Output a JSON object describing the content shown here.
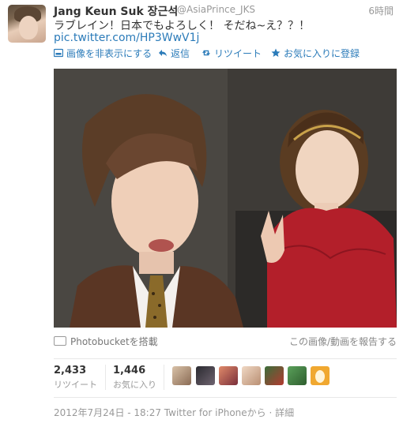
{
  "header": {
    "name": "Jang Keun Suk 장근석",
    "handle": "@AsiaPrince_JKS",
    "time": "6時間"
  },
  "tweet": {
    "text": "ラブレイン！日本でもよろしく！ そだね~え？？！",
    "link": "pic.twitter.com/HP3WwV1j"
  },
  "actions": {
    "hide_image": "画像を非表示にする",
    "reply": "返信",
    "retweet": "リツイート",
    "favorite": "お気に入りに登録"
  },
  "photo_footer": {
    "photobucket": "Photobucketを搭載",
    "report": "この画像/動画を報告する"
  },
  "stats": {
    "retweets": {
      "count": "2,433",
      "label": "リツイート"
    },
    "favorites": {
      "count": "1,446",
      "label": "お気に入り"
    }
  },
  "footer": {
    "meta": "2012年7月24日 - 18:27 Twitter for iPhoneから",
    "detail": "詳細"
  },
  "colors": {
    "link": "#2b7bb9",
    "muted": "#999999",
    "text": "#333333"
  }
}
